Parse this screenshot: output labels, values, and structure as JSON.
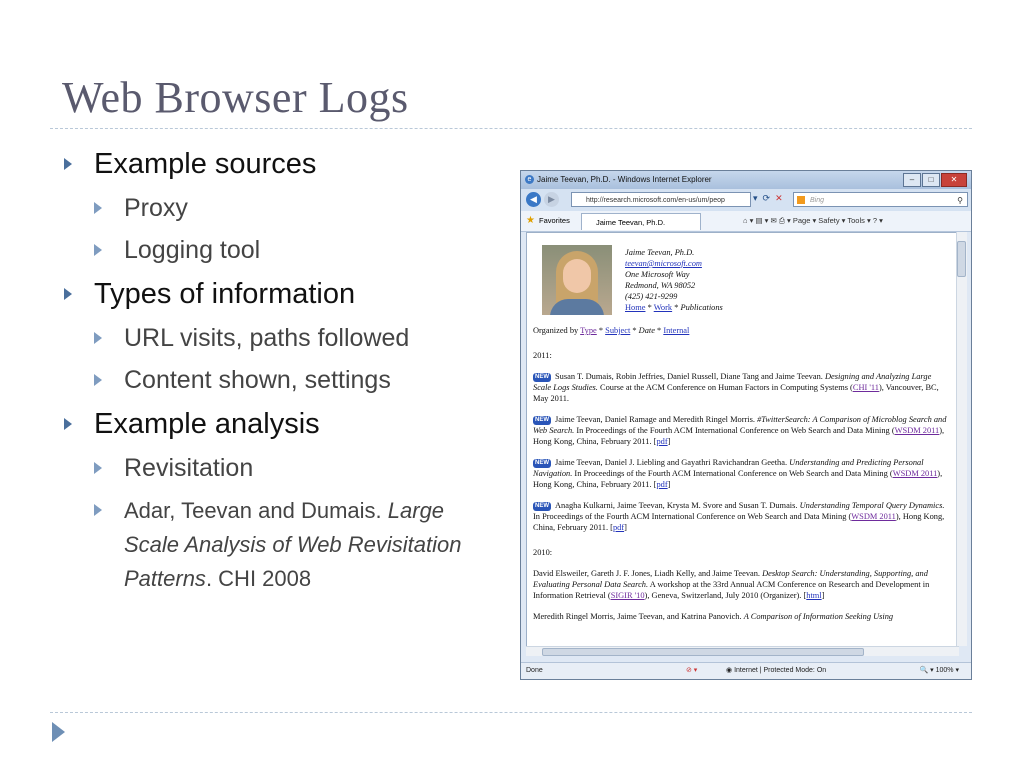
{
  "slide": {
    "title": "Web Browser Logs",
    "bullets": [
      {
        "text": "Example sources",
        "sub": [
          "Proxy",
          "Logging tool"
        ]
      },
      {
        "text": "Types of information",
        "sub": [
          "URL visits, paths followed",
          "Content shown, settings"
        ]
      },
      {
        "text": "Example analysis",
        "sub": [
          "Revisitation"
        ]
      }
    ],
    "citation": {
      "authors": "Adar, Teevan and Dumais.",
      "title": "Large Scale Analysis of Web Revisitation Patterns",
      "venue": ". CHI 2008"
    }
  },
  "browser": {
    "window_title": "Jaime Teevan, Ph.D. - Windows Internet Explorer",
    "address": "http://research.microsoft.com/en-us/um/peop",
    "search_placeholder": "Bing",
    "favorites_label": "Favorites",
    "tab_label": "Jaime Teevan, Ph.D.",
    "tools_text": "Page ▾  Safety ▾  Tools ▾",
    "status_done": "Done",
    "status_zone": "Internet | Protected Mode: On",
    "status_zoom": "100%",
    "profile": {
      "name": "Jaime Teevan, Ph.D.",
      "email": "teevan@microsoft.com",
      "address1": "One Microsoft Way",
      "address2": "Redmond, WA 98052",
      "phone": "(425) 421-9299",
      "nav_home": "Home",
      "nav_work": "Work",
      "nav_pubs": "Publications"
    },
    "organized": {
      "prefix": "Organized by",
      "type": "Type",
      "subject": "Subject",
      "date": "Date",
      "internal": "Internal"
    },
    "year1": "2011:",
    "year2": "2010:",
    "new_badge": "NEW",
    "pubs": [
      {
        "authors": "Susan T. Dumais, Robin Jeffries, Daniel Russell, Diane Tang and Jaime Teevan.",
        "title": "Designing and Analyzing Large Scale Logs Studies.",
        "rest1": "Course at the ACM Conference on Human Factors in Computing Systems (",
        "link": "CHI '11",
        "rest2": "), Vancouver, BC, May 2011."
      },
      {
        "authors": "Jaime Teevan, Daniel Ramage and Meredith Ringel Morris.",
        "title": "#TwitterSearch: A Comparison of Microblog Search and Web Search.",
        "rest1": "In Proceedings of the Fourth ACM International Conference on Web Search and Data Mining (",
        "link": "WSDM 2011",
        "rest2": "), Hong Kong, China, February 2011. [",
        "pdf": "pdf",
        "rest3": "]"
      },
      {
        "authors": "Jaime Teevan, Daniel J. Liebling and Gayathri Ravichandran Geetha.",
        "title": "Understanding and Predicting Personal Navigation.",
        "rest1": "In Proceedings of the Fourth ACM International Conference on Web Search and Data Mining (",
        "link": "WSDM 2011",
        "rest2": "), Hong Kong, China, February 2011. [",
        "pdf": "pdf",
        "rest3": "]"
      },
      {
        "authors": "Anagha Kulkarni, Jaime Teevan, Krysta M. Svore and Susan T. Dumais.",
        "title": "Understanding Temporal Query Dynamics.",
        "rest1": "In Proceedings of the Fourth ACM International Conference on Web Search and Data Mining (",
        "link": "WSDM 2011",
        "rest2": "), Hong Kong, China, February 2011. [",
        "pdf": "pdf",
        "rest3": "]"
      },
      {
        "authors": "David Elsweiler, Gareth J. F. Jones, Liadh Kelly, and Jaime Teevan.",
        "title": "Desktop Search: Understanding, Supporting, and Evaluating Personal Data Search.",
        "rest1": "A workshop at the 33rd Annual ACM Conference on Research and Development in Information Retrieval (",
        "link": "SIGIR '10",
        "rest2": "), Geneva, Switzerland, July 2010 (Organizer).",
        "html": "html"
      },
      {
        "authors": "Meredith Ringel Morris, Jaime Teevan, and Katrina Panovich.",
        "title": "A Comparison of Information Seeking Using"
      }
    ]
  }
}
